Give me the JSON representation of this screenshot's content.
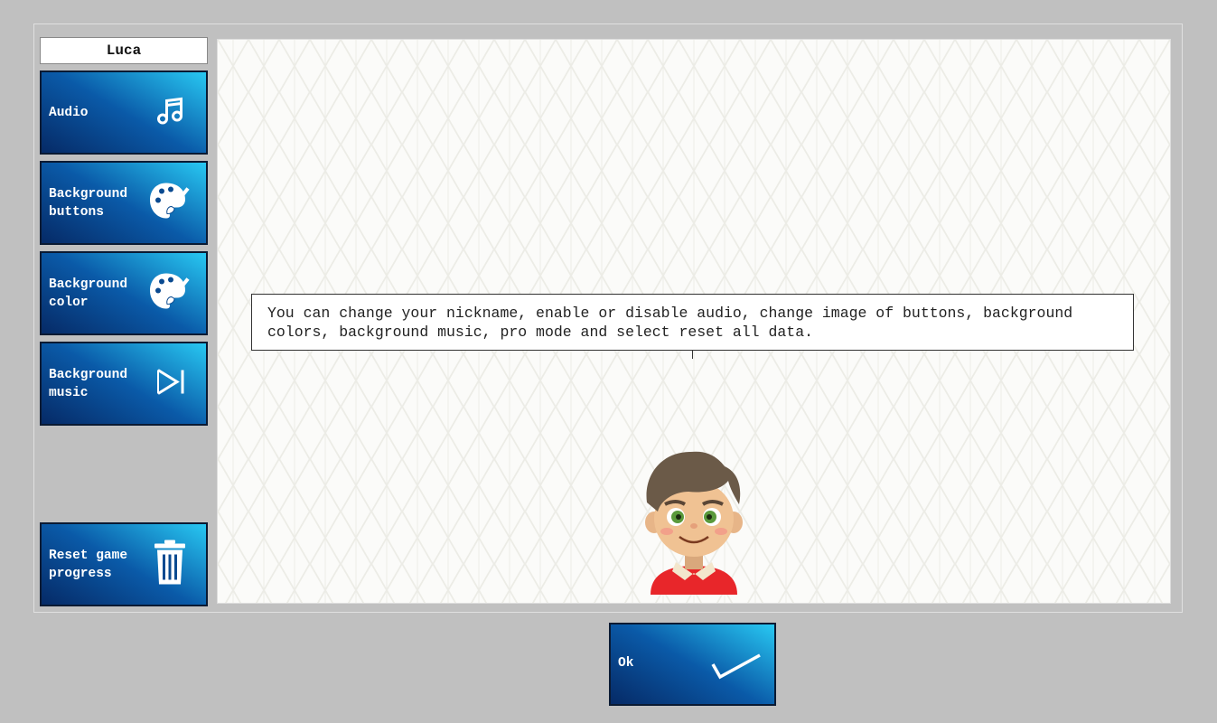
{
  "nickname": "Luca",
  "sidebar": {
    "buttons": [
      {
        "label": "Audio",
        "icon": "music-note-icon"
      },
      {
        "label": "Background\nbuttons",
        "icon": "palette-icon"
      },
      {
        "label": "Background\ncolor",
        "icon": "palette-icon"
      },
      {
        "label": "Background\nmusic",
        "icon": "skip-forward-icon"
      },
      {
        "label": "Reset game\nprogress",
        "icon": "trash-icon"
      }
    ]
  },
  "main": {
    "hint_text": "You can change your nickname, enable or disable audio, change image of buttons, background colors, background music, pro mode and select reset all data."
  },
  "ok_button": {
    "label": "Ok",
    "icon": "checkmark-icon"
  },
  "colors": {
    "button_dark": "#062a66",
    "button_light": "#28c8f2",
    "background": "#c0c0c0"
  }
}
